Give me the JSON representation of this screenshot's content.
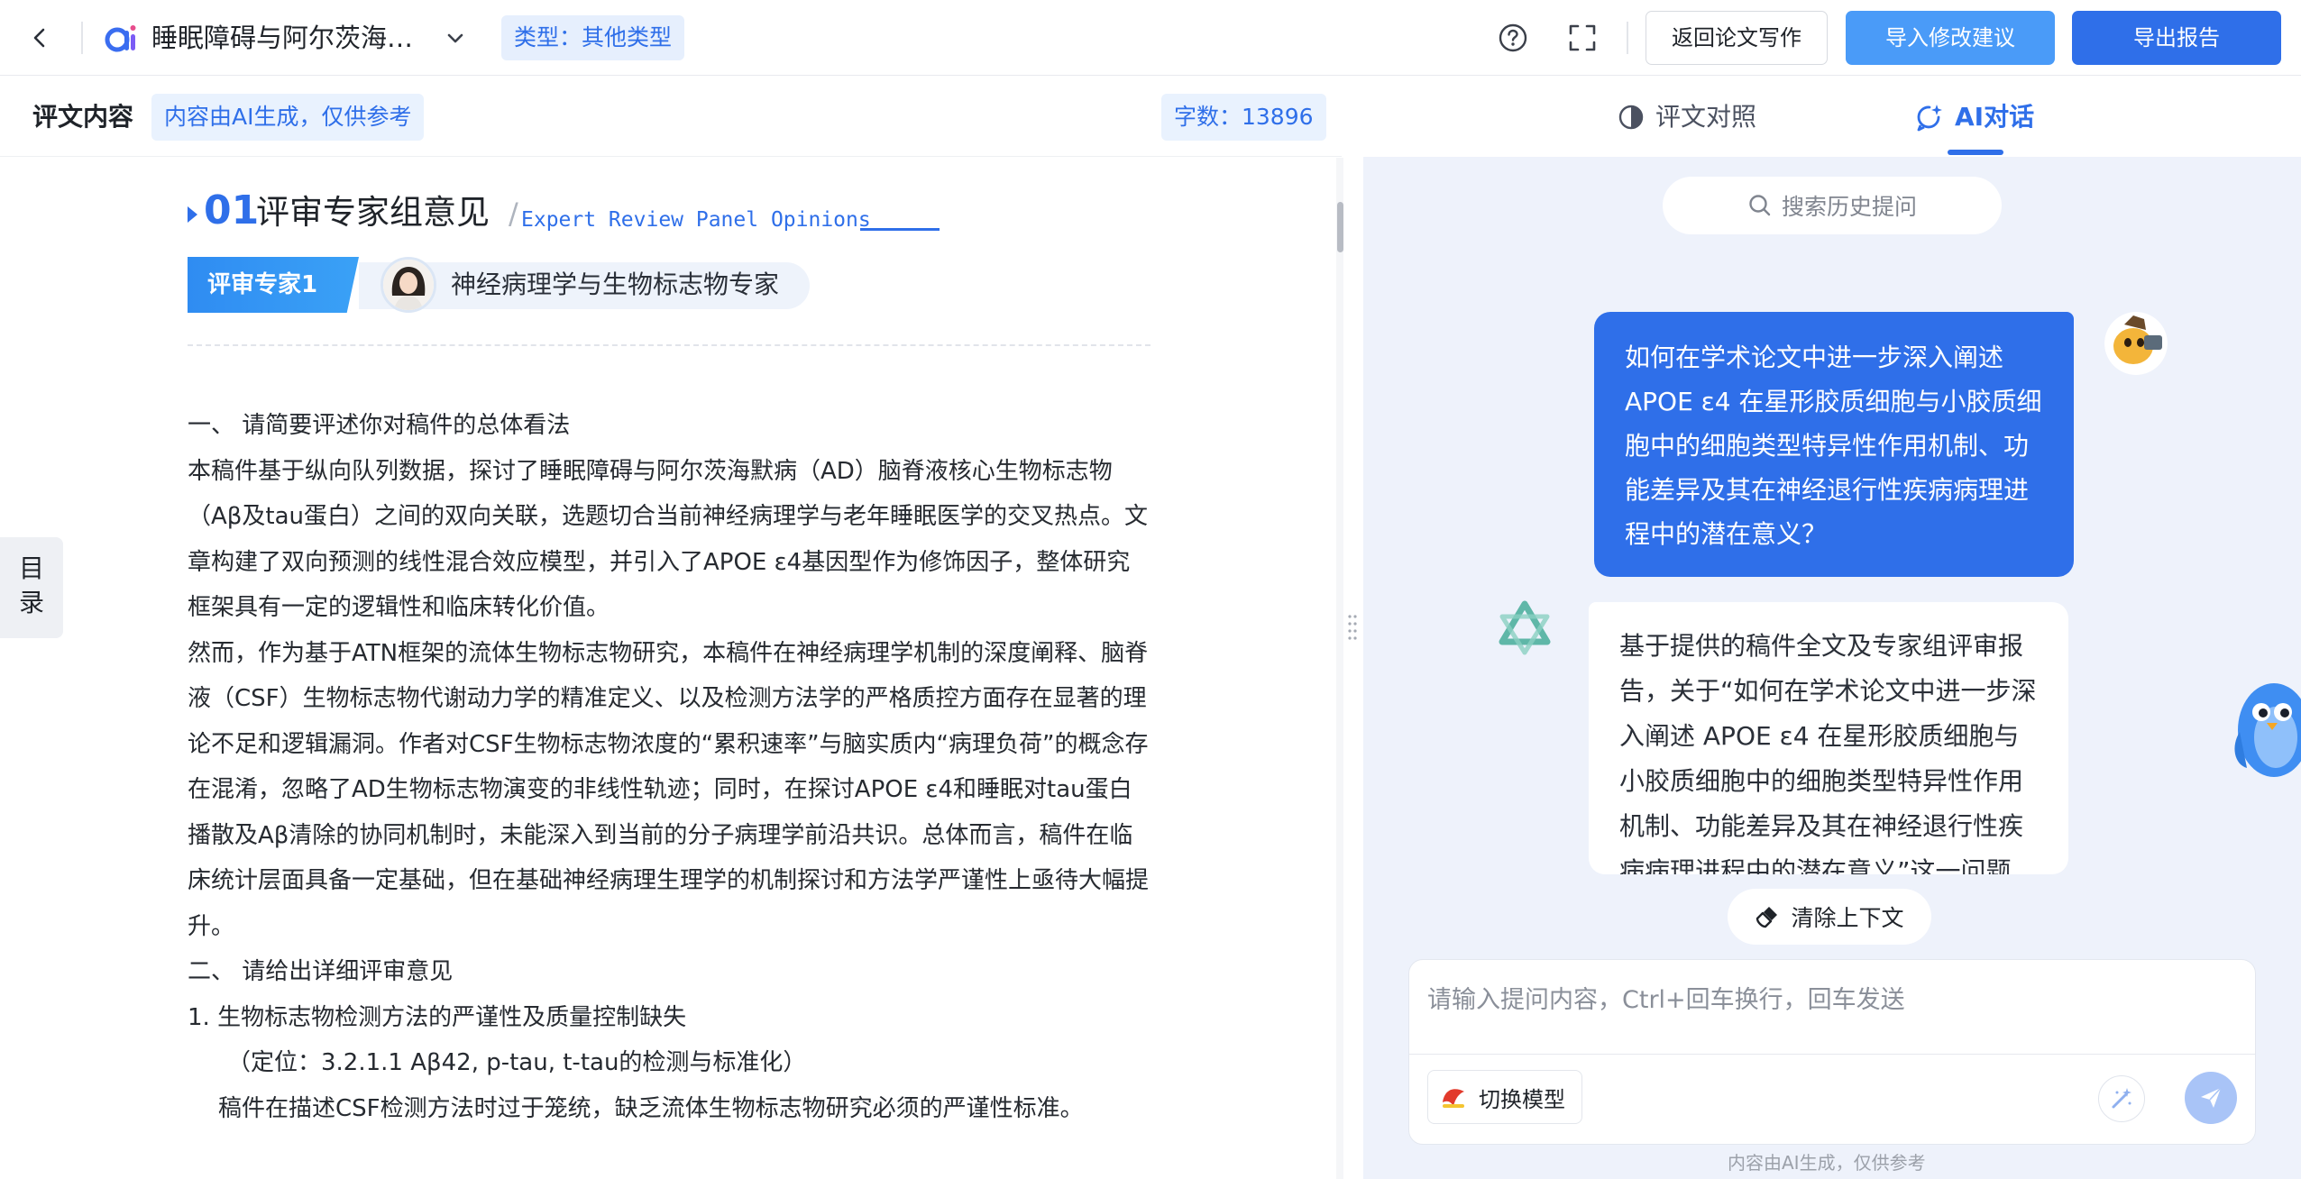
{
  "header": {
    "doc_title": "睡眠障碍与阿尔茨海…",
    "type_badge": "类型：其他类型",
    "return_label": "返回论文写作",
    "import_label": "导入修改建议",
    "export_label": "导出报告",
    "colors": {
      "primary": "#2f6fe9",
      "import_bg": "#4a9bf8"
    }
  },
  "left": {
    "title": "评文内容",
    "ai_notice": "内容由AI生成，仅供参考",
    "word_count": "字数：13896",
    "section": {
      "num": "01",
      "title": "评审专家组意见",
      "slash": "/",
      "subtitle_en": "Expert Review Panel Opinions"
    },
    "reviewer": {
      "label": "评审专家1",
      "role": "神经病理学与生物标志物专家"
    },
    "paragraphs": [
      "一、 请简要评述你对稿件的总体看法",
      "本稿件基于纵向队列数据，探讨了睡眠障碍与阿尔茨海默病（AD）脑脊液核心生物标志物（Aβ及tau蛋白）之间的双向关联，选题切合当前神经病理学与老年睡眠医学的交叉热点。文章构建了双向预测的线性混合效应模型，并引入了APOE ε4基因型作为修饰因子，整体研究框架具有一定的逻辑性和临床转化价值。",
      "然而，作为基于ATN框架的流体生物标志物研究，本稿件在神经病理学机制的深度阐释、脑脊液（CSF）生物标志物代谢动力学的精准定义、以及检测方法学的严格质控方面存在显著的理论不足和逻辑漏洞。作者对CSF生物标志物浓度的“累积速率”与脑实质内“病理负荷”的概念存在混淆，忽略了AD生物标志物演变的非线性轨迹；同时，在探讨APOE ε4和睡眠对tau蛋白播散及Aβ清除的协同机制时，未能深入到当前的分子病理学前沿共识。总体而言，稿件在临床统计层面具备一定基础，但在基础神经病理生理学的机制探讨和方法学严谨性上亟待大幅提升。",
      "二、 请给出详细评审意见"
    ],
    "item1_title": "1. 生物标志物检测方法的严谨性及质量控制缺失",
    "item1_location": "（定位：3.2.1.1 Aβ42, p-tau, t-tau的检测与标准化）",
    "item1_text": "稿件在描述CSF检测方法时过于笼统，缺乏流体生物标志物研究必须的严谨性标准。",
    "toc_label": "目录"
  },
  "right": {
    "tab_compare": "评文对照",
    "tab_ai": "AI对话",
    "history_placeholder": "搜索历史提问",
    "user_question": "如何在学术论文中进一步深入阐述 APOE ε4 在星形胶质细胞与小胶质细胞中的细胞类型特异性作用机制、功能差异及其在神经退行性疾病病理进程中的潜在意义？",
    "bot_answer": "基于提供的稿件全文及专家组评审报告，关于“如何在学术论文中进一步深入阐述 APOE ε4 在星形胶质细胞与小胶质细胞中的细胞类型特异性作用机制、功能差异及其在神经退行性疾病病理进程中的潜在意义”这一问题",
    "clear_context": "清除上下文",
    "input_placeholder": "请输入提问内容，Ctrl+回车换行，回车发送",
    "switch_model": "切换模型",
    "footnote": "内容由AI生成，仅供参考"
  },
  "icons": {
    "back": "chevron-left-icon",
    "logo": "ai-logo-icon",
    "dropdown": "chevron-down-icon",
    "help": "help-circle-icon",
    "fullscreen": "fullscreen-icon",
    "compare": "contrast-icon",
    "ai_chat": "chat-spark-icon",
    "search": "search-icon",
    "clear": "broom-icon",
    "magic": "magic-wand-icon",
    "send": "send-icon"
  }
}
